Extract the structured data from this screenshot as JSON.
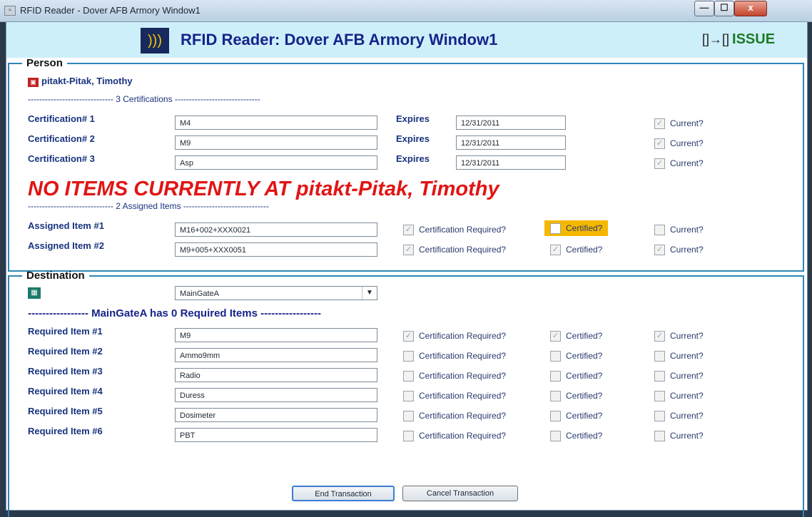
{
  "window": {
    "title": "RFID Reader - Dover AFB Armory Window1",
    "app_icon": "app-icon"
  },
  "caption_buttons": {
    "minimize": "—",
    "maximize": "☐",
    "close": "x"
  },
  "banner": {
    "title": "RFID Reader: Dover AFB Armory Window1",
    "mode": "ISSUE",
    "mode_color": "#1e7a27"
  },
  "person": {
    "legend": "Person",
    "name": "pitakt-Pitak, Timothy",
    "cert_header": "------------------------------ 3 Certifications ------------------------------",
    "certifications": [
      {
        "label": "Certification# 1",
        "value": "M4",
        "expires_label": "Expires",
        "expires": "12/31/2011",
        "current_label": "Current?"
      },
      {
        "label": "Certification# 2",
        "value": "M9",
        "expires_label": "Expires",
        "expires": "12/31/2011",
        "current_label": "Current?"
      },
      {
        "label": "Certification# 3",
        "value": "Asp",
        "expires_label": "Expires",
        "expires": "12/31/2011",
        "current_label": "Current?"
      }
    ],
    "warning": "NO ITEMS CURRENTLY AT pitakt-Pitak, Timothy",
    "assigned_header": "------------------------------ 2 Assigned Items ------------------------------",
    "assigned": [
      {
        "label": "Assigned Item #1",
        "value": "M16+002+XXX0021",
        "cert_req": "Certification Required?",
        "certified": "Certified?",
        "current": "Current?"
      },
      {
        "label": "Assigned Item #2",
        "value": "M9+005+XXX0051",
        "cert_req": "Certification Required?",
        "certified": "Certified?",
        "current": "Current?"
      }
    ]
  },
  "destination": {
    "legend": "Destination",
    "selected": "MainGateA",
    "required_header": "----------------- MainGateA has 0 Required Items -----------------",
    "required": [
      {
        "label": "Required Item #1",
        "value": "M9",
        "cert_req": "Certification Required?",
        "certified": "Certified?",
        "current": "Current?"
      },
      {
        "label": "Required Item #2",
        "value": "Ammo9mm",
        "cert_req": "Certification Required?",
        "certified": "Certified?",
        "current": "Current?"
      },
      {
        "label": "Required Item #3",
        "value": "Radio",
        "cert_req": "Certification Required?",
        "certified": "Certified?",
        "current": "Current?"
      },
      {
        "label": "Required Item #4",
        "value": "Duress",
        "cert_req": "Certification Required?",
        "certified": "Certified?",
        "current": "Current?"
      },
      {
        "label": "Required Item #5",
        "value": "Dosimeter",
        "cert_req": "Certification Required?",
        "certified": "Certified?",
        "current": "Current?"
      },
      {
        "label": "Required Item #6",
        "value": "PBT",
        "cert_req": "Certification Required?",
        "certified": "Certified?",
        "current": "Current?"
      }
    ]
  },
  "footer": {
    "end_label": "End Transaction",
    "cancel_label": "Cancel Transaction"
  },
  "colors": {
    "accent": "#2f86b8",
    "warning": "#e11515",
    "highlight": "#f5b800"
  }
}
